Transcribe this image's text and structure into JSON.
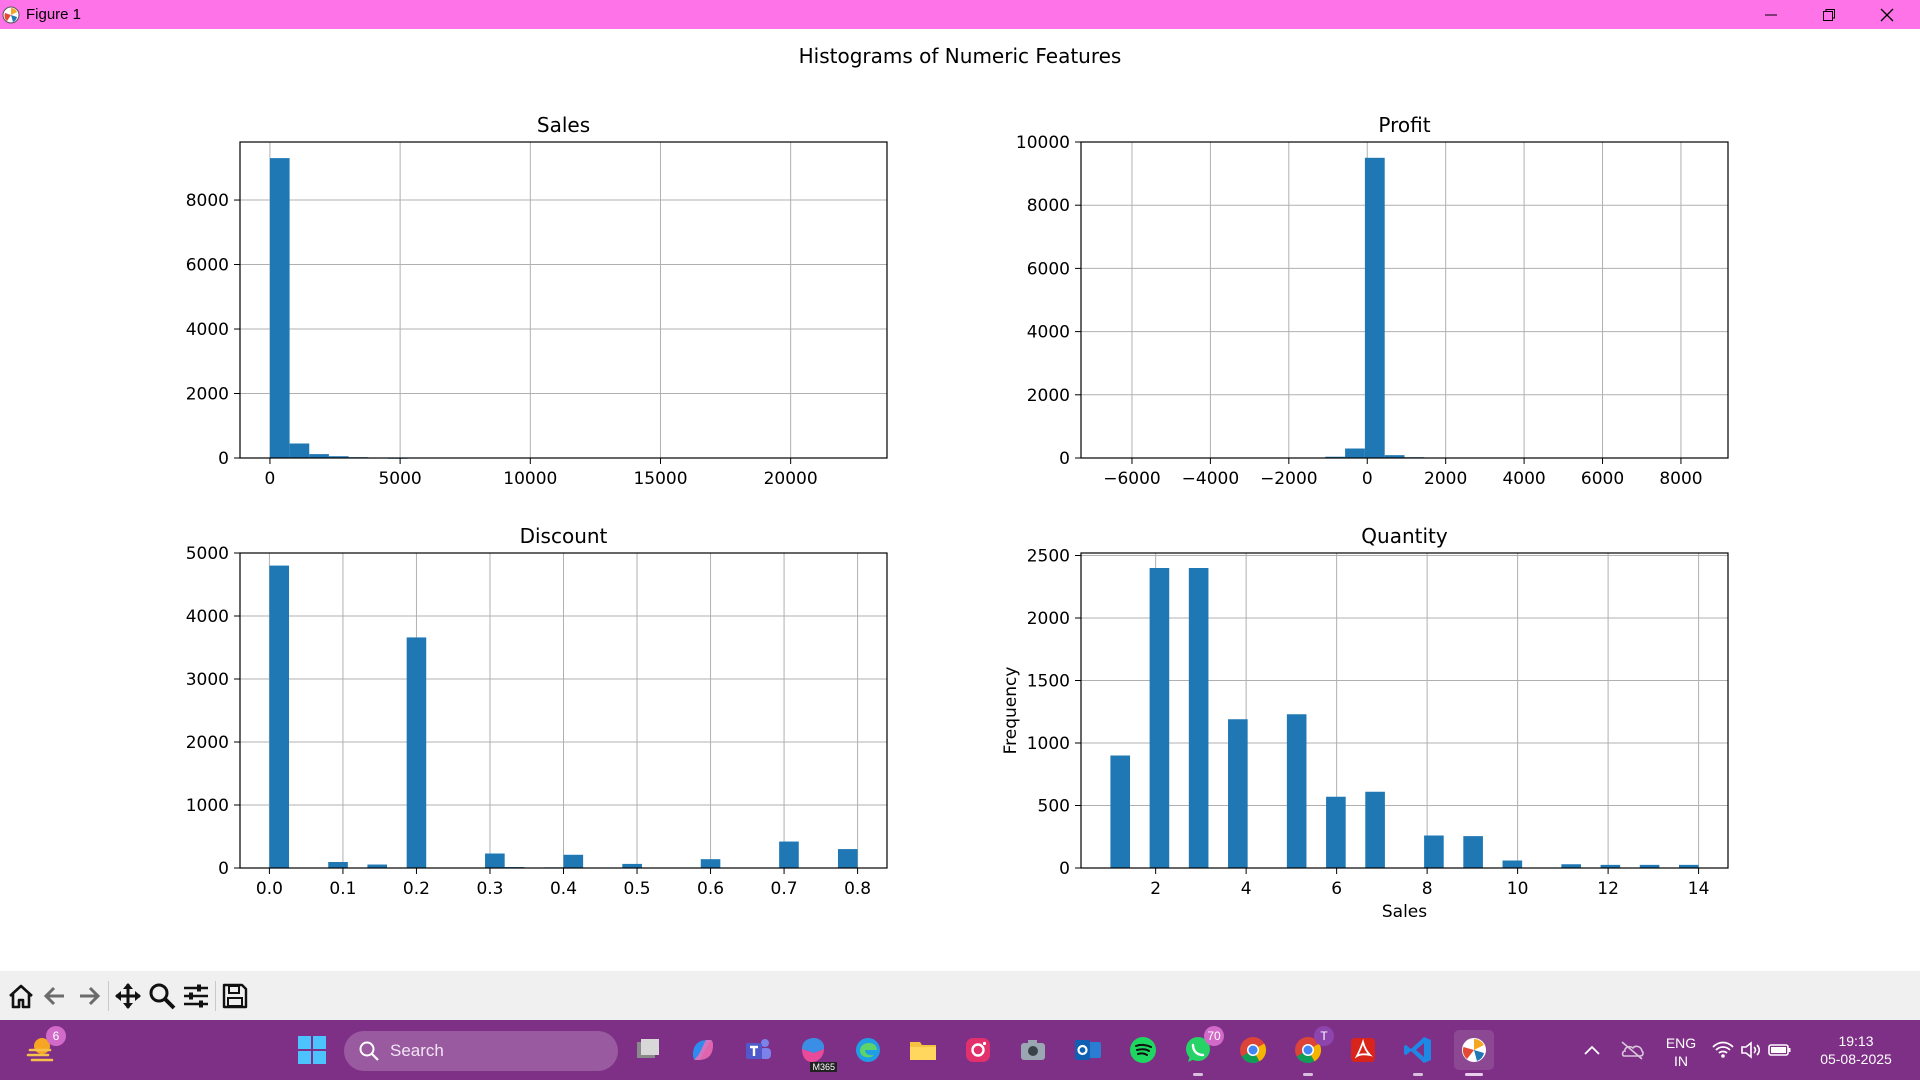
{
  "window": {
    "title": "Figure 1",
    "controls": [
      "minimize-icon",
      "restore-icon",
      "close-icon"
    ],
    "titlebar_color": "#ff73e8"
  },
  "figure": {
    "suptitle": "Histograms of Numeric Features"
  },
  "chart_data": [
    {
      "type": "bar",
      "title": "Sales",
      "xlabel": "",
      "ylabel": "",
      "bar_color": "#1f77b4",
      "grid": true,
      "xlim": [
        -1150,
        23700
      ],
      "ylim": [
        0,
        9800
      ],
      "xticks": [
        0,
        5000,
        10000,
        15000,
        20000
      ],
      "yticks": [
        0,
        2000,
        4000,
        6000,
        8000
      ],
      "bins": [
        {
          "x0": 0,
          "x1": 755,
          "value": 9300
        },
        {
          "x0": 755,
          "x1": 1510,
          "value": 450
        },
        {
          "x0": 1510,
          "x1": 2265,
          "value": 120
        },
        {
          "x0": 2265,
          "x1": 3020,
          "value": 55
        },
        {
          "x0": 3020,
          "x1": 3775,
          "value": 25
        },
        {
          "x0": 3775,
          "x1": 4530,
          "value": 15
        },
        {
          "x0": 4530,
          "x1": 5285,
          "value": 8
        }
      ]
    },
    {
      "type": "bar",
      "title": "Profit",
      "xlabel": "",
      "ylabel": "",
      "bar_color": "#1f77b4",
      "grid": true,
      "xlim": [
        -7300,
        9200
      ],
      "ylim": [
        0,
        10000
      ],
      "xticks": [
        -6000,
        -4000,
        -2000,
        0,
        2000,
        4000,
        6000,
        8000
      ],
      "yticks": [
        0,
        2000,
        4000,
        6000,
        8000,
        10000
      ],
      "bins": [
        {
          "x0": -1070,
          "x1": -565,
          "value": 40
        },
        {
          "x0": -565,
          "x1": -60,
          "value": 300
        },
        {
          "x0": -60,
          "x1": 445,
          "value": 9500
        },
        {
          "x0": 445,
          "x1": 950,
          "value": 90
        },
        {
          "x0": 950,
          "x1": 1455,
          "value": 25
        }
      ]
    },
    {
      "type": "bar",
      "title": "Discount",
      "xlabel": "",
      "ylabel": "",
      "bar_color": "#1f77b4",
      "grid": true,
      "xlim": [
        -0.04,
        0.84
      ],
      "ylim": [
        0,
        5000
      ],
      "xticks": [
        0.0,
        0.1,
        0.2,
        0.3,
        0.4,
        0.5,
        0.6,
        0.7,
        0.8
      ],
      "yticks": [
        0,
        1000,
        2000,
        3000,
        4000,
        5000
      ],
      "bins": [
        {
          "x0": 0.0,
          "x1": 0.0267,
          "value": 4800
        },
        {
          "x0": 0.08,
          "x1": 0.1067,
          "value": 95
        },
        {
          "x0": 0.1333,
          "x1": 0.16,
          "value": 55
        },
        {
          "x0": 0.1867,
          "x1": 0.2133,
          "value": 3660
        },
        {
          "x0": 0.2933,
          "x1": 0.32,
          "value": 230
        },
        {
          "x0": 0.32,
          "x1": 0.3467,
          "value": 15
        },
        {
          "x0": 0.3733,
          "x1": 0.4,
          "value": 10
        },
        {
          "x0": 0.4,
          "x1": 0.4267,
          "value": 210
        },
        {
          "x0": 0.48,
          "x1": 0.5067,
          "value": 65
        },
        {
          "x0": 0.5867,
          "x1": 0.6133,
          "value": 140
        },
        {
          "x0": 0.6933,
          "x1": 0.72,
          "value": 420
        },
        {
          "x0": 0.7733,
          "x1": 0.8,
          "value": 300
        }
      ]
    },
    {
      "type": "bar",
      "title": "Quantity",
      "xlabel": "Sales",
      "ylabel": "Frequency",
      "bar_color": "#1f77b4",
      "grid": true,
      "xlim": [
        0.35,
        14.65
      ],
      "ylim": [
        0,
        2520
      ],
      "xticks": [
        2,
        4,
        6,
        8,
        10,
        12,
        14
      ],
      "yticks": [
        0,
        500,
        1000,
        1500,
        2000,
        2500
      ],
      "bins": [
        {
          "x0": 1.0,
          "x1": 1.4333,
          "value": 900
        },
        {
          "x0": 1.8667,
          "x1": 2.3,
          "value": 2400
        },
        {
          "x0": 2.7333,
          "x1": 3.1667,
          "value": 2400
        },
        {
          "x0": 3.6,
          "x1": 4.0333,
          "value": 1190
        },
        {
          "x0": 4.9,
          "x1": 5.3333,
          "value": 1230
        },
        {
          "x0": 5.7667,
          "x1": 6.2,
          "value": 570
        },
        {
          "x0": 6.6333,
          "x1": 7.0667,
          "value": 610
        },
        {
          "x0": 7.9333,
          "x1": 8.3667,
          "value": 260
        },
        {
          "x0": 8.8,
          "x1": 9.2333,
          "value": 255
        },
        {
          "x0": 9.6667,
          "x1": 10.1,
          "value": 60
        },
        {
          "x0": 10.9667,
          "x1": 11.4,
          "value": 30
        },
        {
          "x0": 11.8333,
          "x1": 12.2667,
          "value": 25
        },
        {
          "x0": 12.7,
          "x1": 13.1333,
          "value": 25
        },
        {
          "x0": 13.5667,
          "x1": 14.0,
          "value": 25
        }
      ]
    }
  ],
  "toolbar": {
    "buttons": [
      "home-icon",
      "back-icon",
      "forward-icon",
      "pan-icon",
      "zoom-icon",
      "configure-subplots-icon",
      "save-icon"
    ]
  },
  "taskbar": {
    "weather_badge": "6",
    "search_placeholder": "Search",
    "whatsapp_badge": "70",
    "chrome_profile_badge": "T",
    "m365_label": "M365",
    "language": "ENG",
    "region": "IN",
    "time": "19:13",
    "date": "05-08-2025",
    "background_color": "#7e2f86"
  }
}
